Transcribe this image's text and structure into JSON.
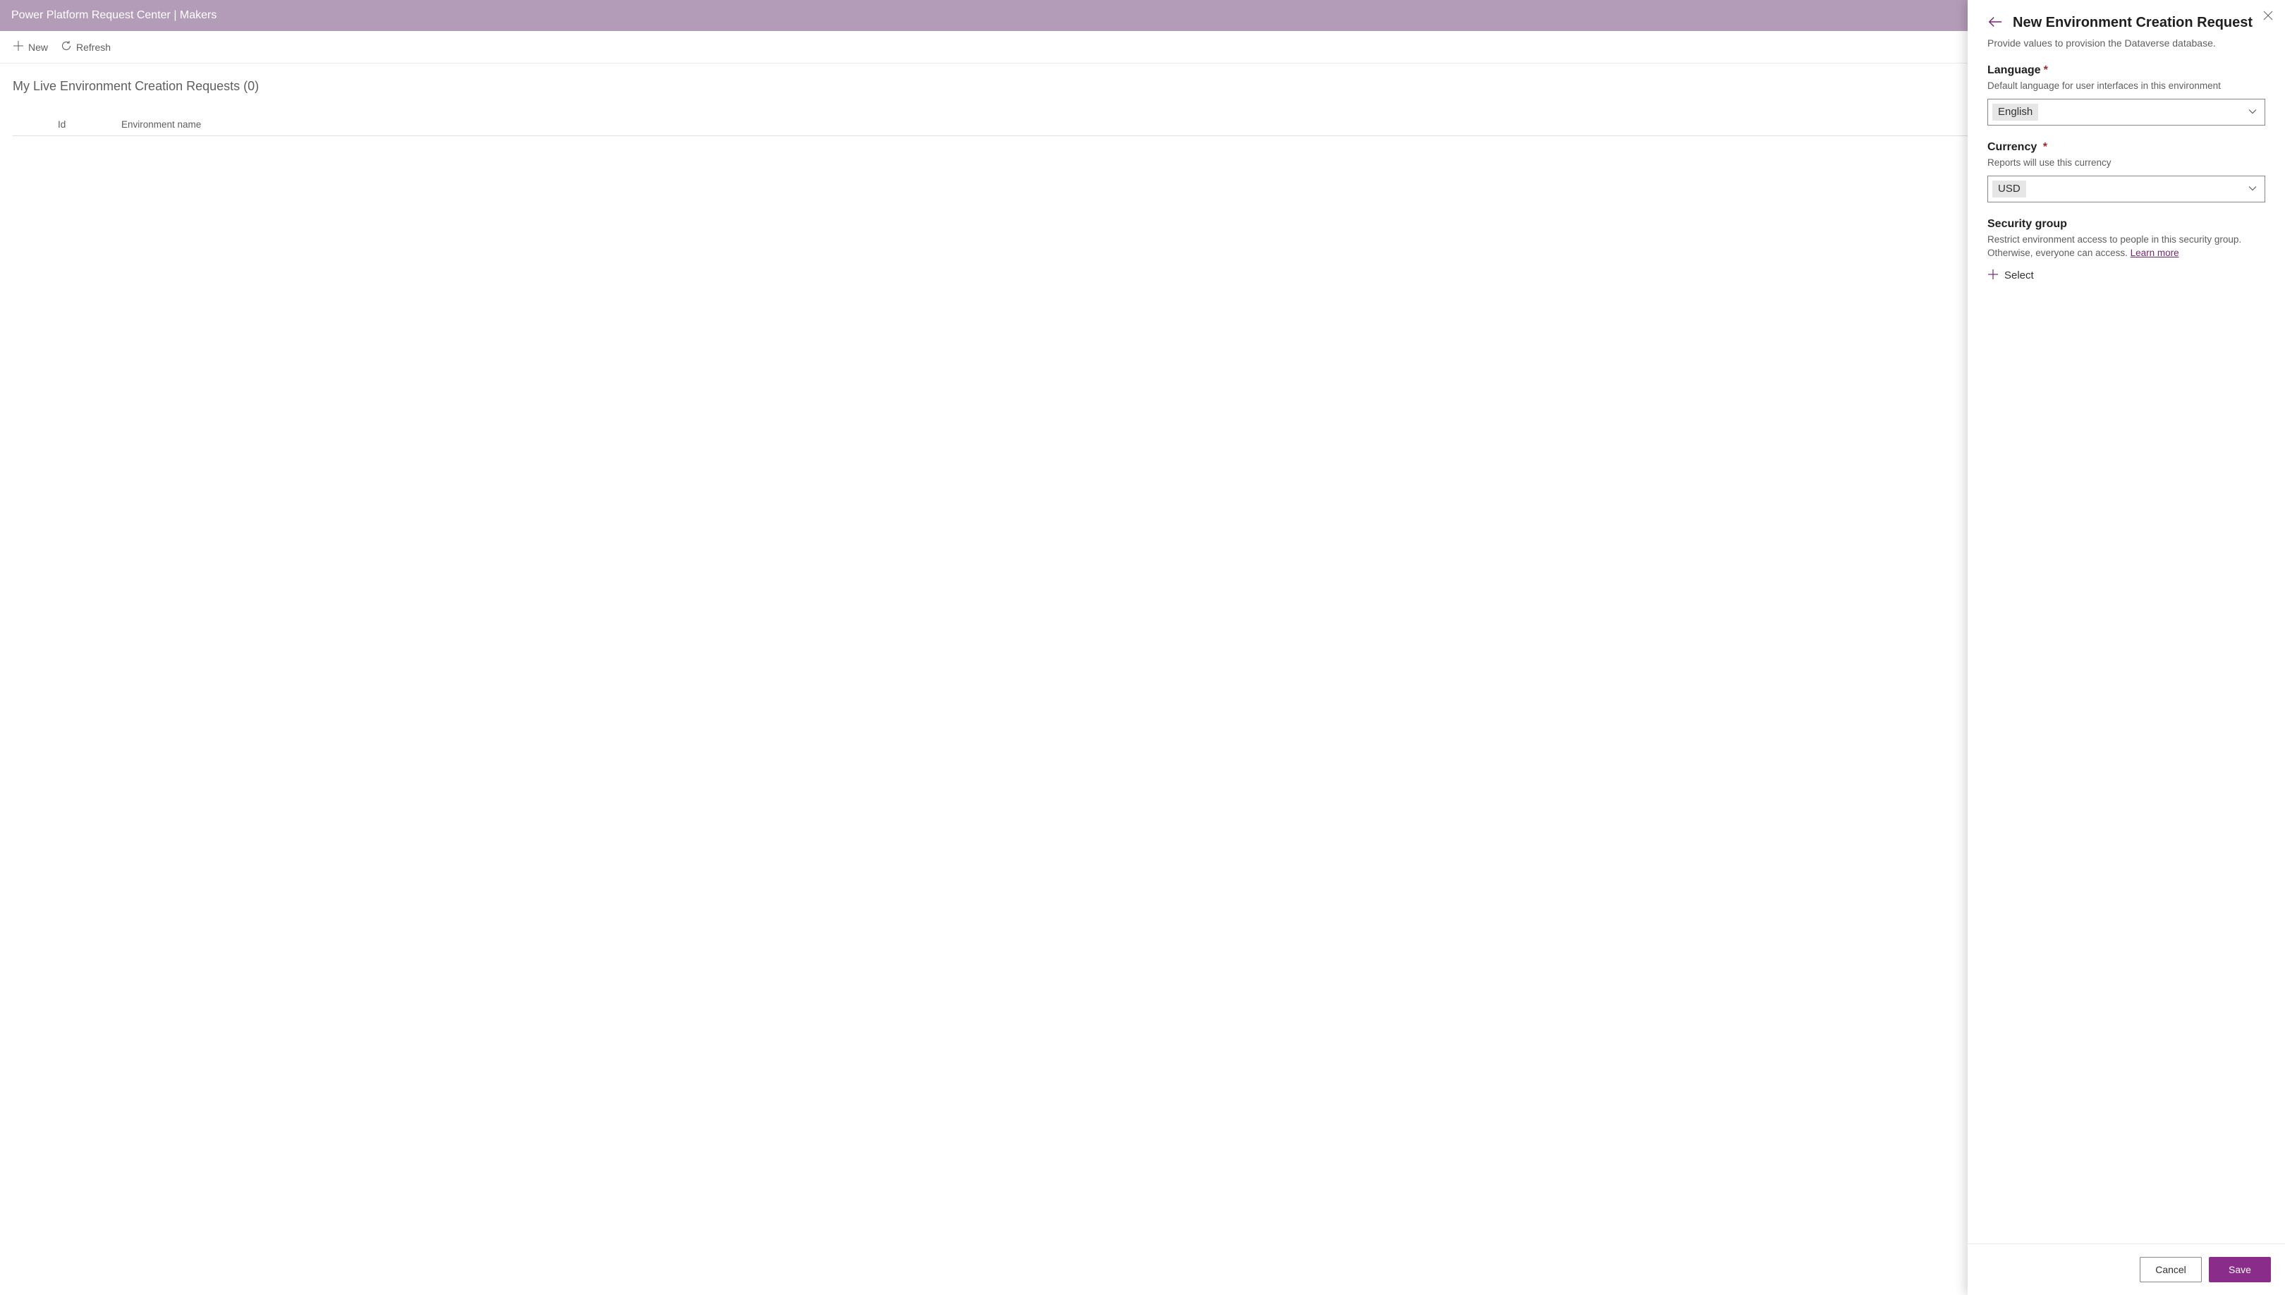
{
  "header": {
    "title": "Power Platform Request Center | Makers"
  },
  "commandBar": {
    "new_label": "New",
    "refresh_label": "Refresh"
  },
  "list": {
    "title": "My Live Environment Creation Requests (0)",
    "columns": {
      "id": "Id",
      "env_name": "Environment name"
    }
  },
  "panel": {
    "title": "New Environment Creation Request",
    "subtitle": "Provide values to provision the Dataverse database.",
    "fields": {
      "language": {
        "label": "Language",
        "required": true,
        "desc": "Default language for user interfaces in this environment",
        "value": "English"
      },
      "currency": {
        "label": "Currency",
        "required": true,
        "desc": "Reports will use this currency",
        "value": "USD"
      },
      "security_group": {
        "label": "Security group",
        "required": false,
        "desc_pre": "Restrict environment access to people in this security group. Otherwise, everyone can access. ",
        "learn_more": "Learn more",
        "select_label": "Select"
      }
    },
    "footer": {
      "cancel": "Cancel",
      "save": "Save"
    }
  }
}
